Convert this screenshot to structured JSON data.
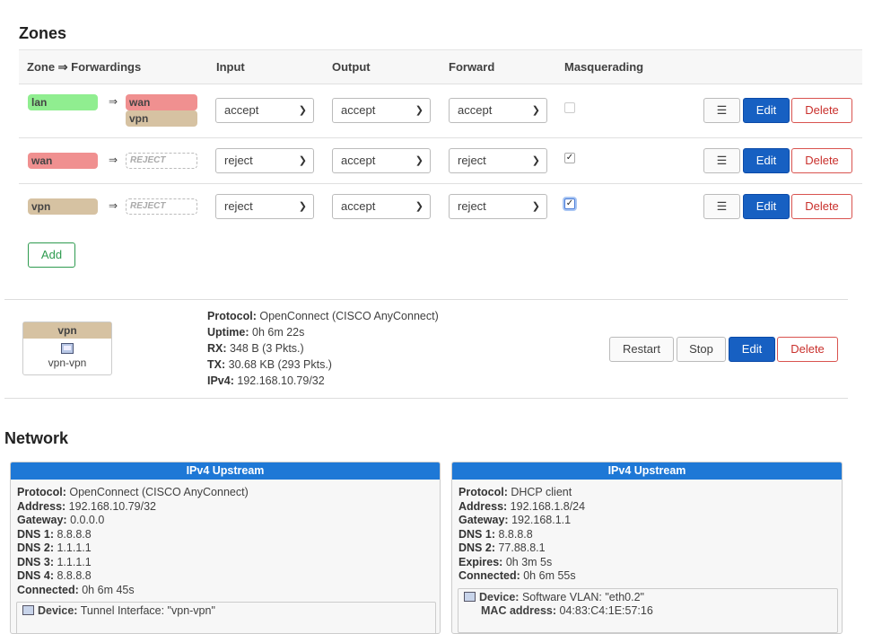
{
  "zones": {
    "title": "Zones",
    "headers": {
      "zone_forwardings": "Zone ⇒ Forwardings",
      "input": "Input",
      "output": "Output",
      "forward": "Forward",
      "masquerading": "Masquerading"
    },
    "rows": [
      {
        "zone": "lan",
        "zone_color": "#90ee90",
        "forwardings": [
          "wan",
          "vpn"
        ],
        "input": "accept",
        "output": "accept",
        "forward": "accept",
        "masquerading": false
      },
      {
        "zone": "wan",
        "zone_color": "#f09090",
        "forwardings": [
          "REJECT"
        ],
        "input": "reject",
        "output": "accept",
        "forward": "reject",
        "masquerading": true
      },
      {
        "zone": "vpn",
        "zone_color": "#d6c2a2",
        "forwardings": [
          "REJECT"
        ],
        "input": "reject",
        "output": "accept",
        "forward": "reject",
        "masquerading": true
      }
    ],
    "arrow": "⇒",
    "menu_label": "☰",
    "edit_label": "Edit",
    "delete_label": "Delete",
    "add_label": "Add"
  },
  "interface": {
    "name": "vpn",
    "device": "vpn-vpn",
    "protocol_label": "Protocol:",
    "protocol": "OpenConnect (CISCO AnyConnect)",
    "uptime_label": "Uptime:",
    "uptime": "0h 6m 22s",
    "rx_label": "RX:",
    "rx": "348 B (3 Pkts.)",
    "tx_label": "TX:",
    "tx": "30.68 KB (293 Pkts.)",
    "ipv4_label": "IPv4:",
    "ipv4": "192.168.10.79/32",
    "restart_label": "Restart",
    "stop_label": "Stop",
    "edit_label": "Edit",
    "delete_label": "Delete"
  },
  "network": {
    "title": "Network",
    "upstreams": [
      {
        "header": "IPv4 Upstream",
        "lines": [
          {
            "label": "Protocol:",
            "value": "OpenConnect (CISCO AnyConnect)"
          },
          {
            "label": "Address:",
            "value": "192.168.10.79/32"
          },
          {
            "label": "Gateway:",
            "value": "0.0.0.0"
          },
          {
            "label": "DNS 1:",
            "value": "8.8.8.8"
          },
          {
            "label": "DNS 2:",
            "value": "1.1.1.1"
          },
          {
            "label": "DNS 3:",
            "value": "1.1.1.1"
          },
          {
            "label": "DNS 4:",
            "value": "8.8.8.8"
          },
          {
            "label": "Connected:",
            "value": "0h 6m 45s"
          }
        ],
        "device_label": "Device:",
        "device": "Tunnel Interface: \"vpn-vpn\""
      },
      {
        "header": "IPv4 Upstream",
        "lines": [
          {
            "label": "Protocol:",
            "value": "DHCP client"
          },
          {
            "label": "Address:",
            "value": "192.168.1.8/24"
          },
          {
            "label": "Gateway:",
            "value": "192.168.1.1"
          },
          {
            "label": "DNS 1:",
            "value": "8.8.8.8"
          },
          {
            "label": "DNS 2:",
            "value": "77.88.8.1"
          },
          {
            "label": "Expires:",
            "value": "0h 3m 5s"
          },
          {
            "label": "Connected:",
            "value": "0h 6m 55s"
          }
        ],
        "device_label": "Device:",
        "device": "Software VLAN: \"eth0.2\"",
        "mac_label": "MAC address:",
        "mac": "04:83:C4:1E:57:16"
      }
    ]
  },
  "colors": {
    "primary": "#1760c2",
    "danger": "#c9302c",
    "add": "#2e9b4f",
    "upstream_header": "#1e78d6"
  }
}
